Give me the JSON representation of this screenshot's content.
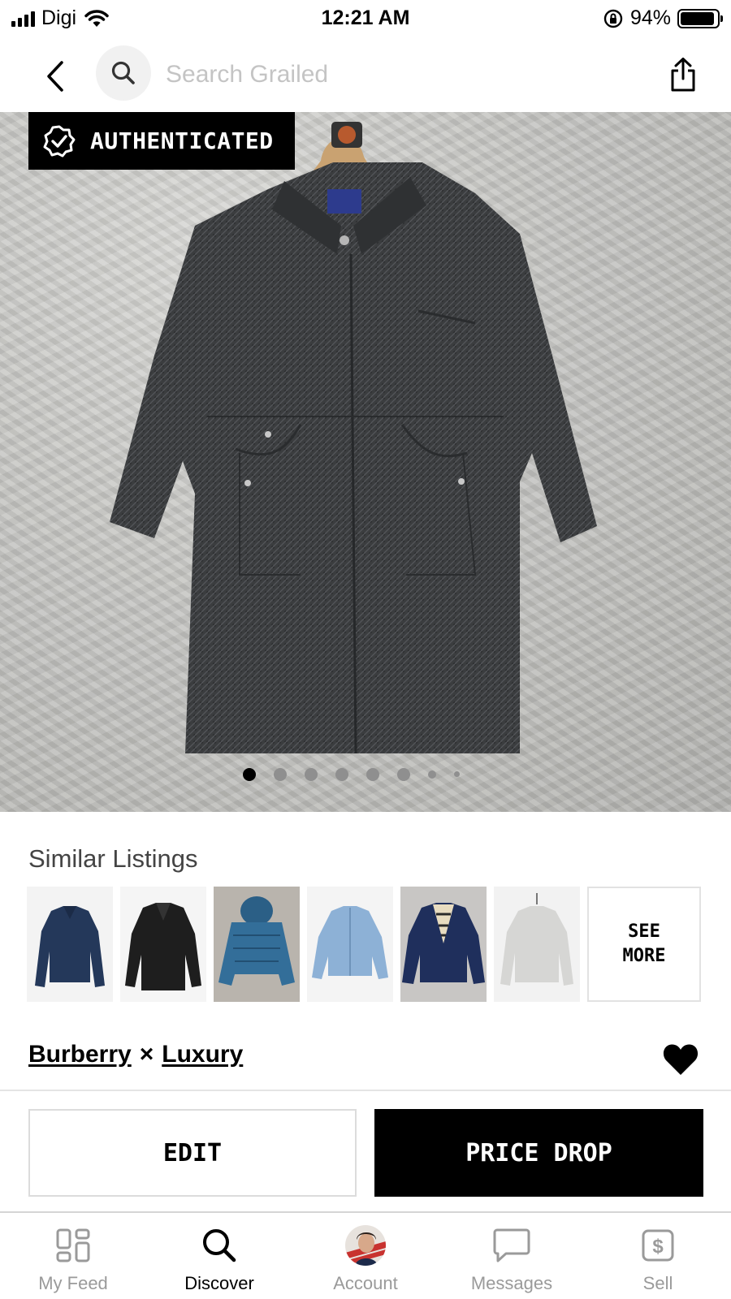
{
  "status_bar": {
    "carrier": "Digi",
    "time": "12:21 AM",
    "battery_percent": "94%",
    "battery_level": 0.94
  },
  "nav": {
    "search_placeholder": "Search Grailed",
    "icons": [
      "back-chevron-icon",
      "search-icon",
      "share-icon"
    ]
  },
  "product": {
    "badge_label": "AUTHENTICATED",
    "image_count": 8,
    "active_image_index": 0
  },
  "similar": {
    "title": "Similar Listings",
    "see_more_label": "SEE\nMORE",
    "thumbnail_count": 6
  },
  "brand": {
    "designer_1": "Burberry",
    "separator": "×",
    "designer_2": "Luxury",
    "favorited": true
  },
  "actions": {
    "edit_label": "EDIT",
    "price_drop_label": "PRICE DROP"
  },
  "tab_bar": {
    "tabs": [
      {
        "label": "My Feed",
        "icon": "grid-icon"
      },
      {
        "label": "Discover",
        "icon": "search-icon"
      },
      {
        "label": "Account",
        "icon": "avatar"
      },
      {
        "label": "Messages",
        "icon": "chat-bubble-icon"
      },
      {
        "label": "Sell",
        "icon": "dollar-tag-icon"
      }
    ],
    "active_tab": "Discover"
  },
  "colors": {
    "primary": "#000000",
    "placeholder": "#c4c4c4",
    "inactive_tab": "#9a9a9a",
    "background": "#ffffff"
  }
}
